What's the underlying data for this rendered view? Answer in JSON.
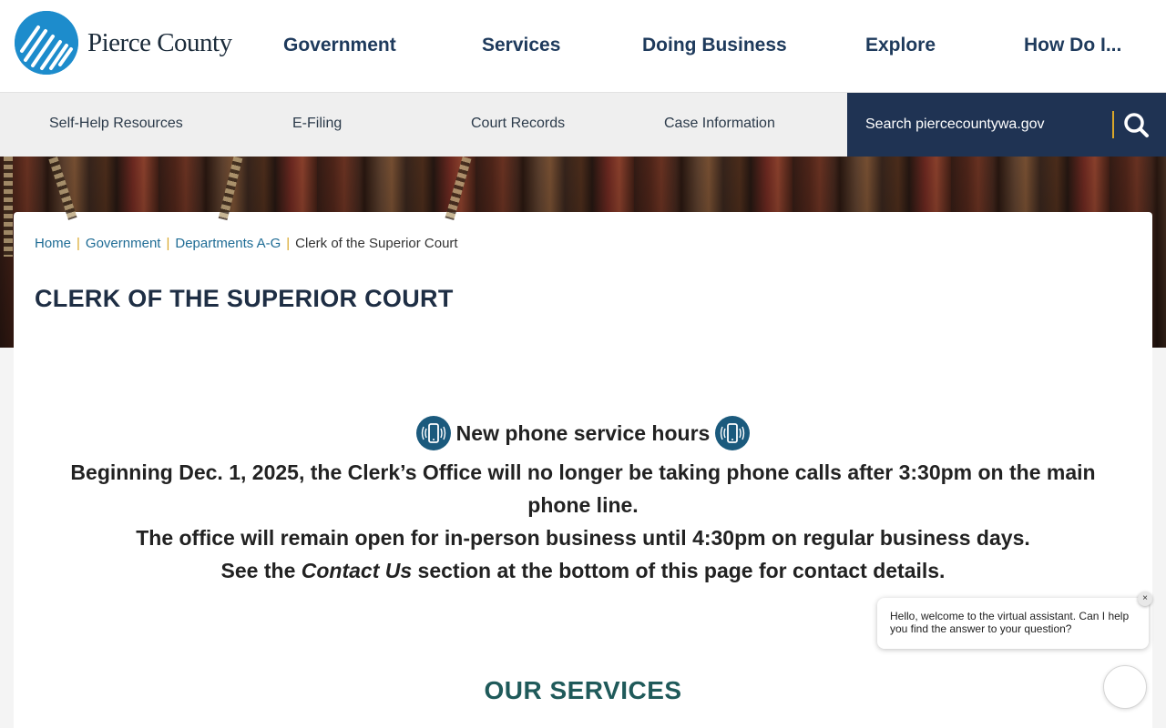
{
  "site": {
    "logo_text": "Pierce County",
    "logo_icon": "pierce-county-mountain-icon"
  },
  "main_nav": [
    "Government",
    "Services",
    "Doing Business",
    "Explore",
    "How Do I..."
  ],
  "sub_nav": [
    "Self-Help Resources",
    "E-Filing",
    "Court Records",
    "Case Information"
  ],
  "search": {
    "placeholder": "Search piercecountywa.gov",
    "icon": "search-icon",
    "bg_color": "#1f3353",
    "accent_color": "#d9a72a"
  },
  "breadcrumb": {
    "items": [
      "Home",
      "Government",
      "Departments A-G"
    ],
    "current": "Clerk of the Superior Court"
  },
  "page_title": "CLERK OF THE SUPERIOR COURT",
  "notice": {
    "heading": "New phone service hours",
    "icon": "mobile-phone-icon",
    "line1": "Beginning Dec. 1, 2025, the Clerk’s Office will no longer be taking phone calls after 3:30pm on the main phone line.",
    "line2": "The office will remain open for in-person business until 4:30pm on regular business days.",
    "line3_before": "See the ",
    "line3_em": "Contact Us",
    "line3_after": " section at the bottom of this page for contact details."
  },
  "services_title": "OUR SERVICES",
  "chat": {
    "message": "Hello, welcome to the virtual assistant. Can I help you find the answer to your question?",
    "close_label": "×"
  },
  "colors": {
    "nav_text": "#1e3a5c",
    "link": "#1f6c95",
    "title": "#1e2e44",
    "services_title": "#1f5a5a"
  }
}
